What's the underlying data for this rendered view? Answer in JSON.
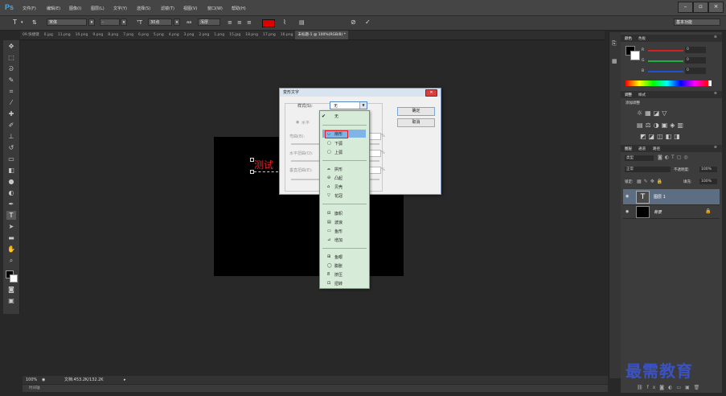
{
  "app": {
    "logo": "Ps"
  },
  "menu": [
    "文件(F)",
    "编辑(E)",
    "图像(I)",
    "图层(L)",
    "文字(Y)",
    "选择(S)",
    "滤镜(T)",
    "视图(V)",
    "窗口(W)",
    "帮助(H)"
  ],
  "window_buttons": {
    "minimize": "–",
    "restore": "▫",
    "close": "×"
  },
  "options": {
    "font_family": "宋体",
    "font_style": "-",
    "font_size": "30点",
    "antialias": "浑厚",
    "workspace": "基本功能"
  },
  "tabs": [
    "09.快捷键",
    "0.jpg",
    "11.png",
    "10.png",
    "9.png",
    "8.png",
    "7.png",
    "6.png",
    "5.png",
    "4.png",
    "3.png",
    "2.png",
    "1.png",
    "15.jpg",
    "18.png",
    "17.png",
    "16.png",
    "未标题-1 @ 100%(RGB/8) *"
  ],
  "canvas": {
    "text": "测试"
  },
  "status": {
    "zoom": "100%",
    "doc": "文档:453.2K/132.2K",
    "bottom_label": "时间轴"
  },
  "dialog": {
    "title": "变形文字",
    "style_label": "样式(S):",
    "style_value": "无",
    "horizontal_label": "水平",
    "bend_label": "弯曲(B):",
    "hdist_label": "水平扭曲(O):",
    "vdist_label": "垂直扭曲(E):",
    "pct": "%",
    "ok": "确定",
    "cancel": "取消"
  },
  "warp_styles": {
    "none": "无",
    "group1": [
      "扇形",
      "下弧",
      "上弧"
    ],
    "group2": [
      "拱形",
      "凸起",
      "贝壳",
      "花冠"
    ],
    "group3": [
      "旗帜",
      "波浪",
      "鱼形",
      "增加"
    ],
    "group4": [
      "鱼眼",
      "膨胀",
      "挤压",
      "扭转"
    ]
  },
  "panels": {
    "color_tabs": [
      "颜色",
      "色板"
    ],
    "color_labels": {
      "r": "R",
      "g": "G",
      "b": "B"
    },
    "color_values": {
      "r": "0",
      "g": "0",
      "b": "0"
    },
    "adjust_tabs": [
      "调整",
      "样式"
    ],
    "adjust_title": "添加调整",
    "layer_tabs": [
      "图层",
      "通道",
      "路径"
    ],
    "layer_kind": "类型",
    "blend_mode": "正常",
    "opacity_label": "不透明度:",
    "opacity": "100%",
    "lock_label": "锁定:",
    "fill_label": "填充:",
    "fill": "100%",
    "layers": [
      {
        "name": "图层 1",
        "thumb": "T",
        "selected": true
      },
      {
        "name": "背景",
        "thumb": "",
        "selected": false
      }
    ]
  },
  "watermark": "最需教育",
  "colors": {
    "ui_dark": "#282828",
    "accent_blue": "#46a9f0",
    "text_red": "#e4252b",
    "dropdown_bg": "#d6ecd9",
    "highlight": "#7fb4e8",
    "watermark": "#3b52c4"
  }
}
